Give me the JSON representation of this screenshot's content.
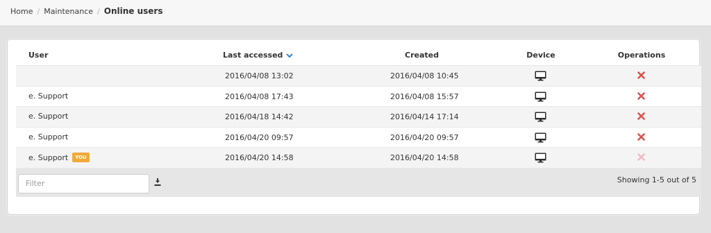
{
  "breadcrumb": {
    "items": [
      "Home",
      "Maintenance"
    ],
    "separator": "/",
    "current": "Online users"
  },
  "table": {
    "headers": {
      "user": "User",
      "last_accessed": "Last accessed",
      "created": "Created",
      "device": "Device",
      "operations": "Operations"
    },
    "sort": {
      "column": "last_accessed",
      "direction": "desc",
      "icon": "chevron-down-icon"
    },
    "rows": [
      {
        "user": "",
        "last_accessed": "2016/04/08 13:02",
        "created": "2016/04/08 10:45",
        "device": "desktop-icon",
        "operation": "delete-icon",
        "you": false
      },
      {
        "user": "e. Support",
        "last_accessed": "2016/04/08 17:43",
        "created": "2016/04/08 15:57",
        "device": "desktop-icon",
        "operation": "delete-icon",
        "you": false
      },
      {
        "user": "e. Support",
        "last_accessed": "2016/04/18 14:42",
        "created": "2016/04/14 17:14",
        "device": "desktop-icon",
        "operation": "delete-icon",
        "you": false
      },
      {
        "user": "e. Support",
        "last_accessed": "2016/04/20 09:57",
        "created": "2016/04/20 09:57",
        "device": "desktop-icon",
        "operation": "delete-icon",
        "you": false
      },
      {
        "user": "e. Support",
        "last_accessed": "2016/04/20 14:58",
        "created": "2016/04/20 14:58",
        "device": "desktop-icon",
        "operation": "delete-icon-disabled",
        "you": true
      }
    ],
    "you_badge": "YOU"
  },
  "footer": {
    "filter_placeholder": "Filter",
    "filter_value": "",
    "download_icon": "download-icon",
    "count_text": "Showing 1-5 out of 5"
  },
  "colors": {
    "delete": "#d9534f",
    "delete_disabled": "#f4b8c3",
    "badge": "#f0a93a",
    "sort_icon": "#3a7fc4"
  }
}
